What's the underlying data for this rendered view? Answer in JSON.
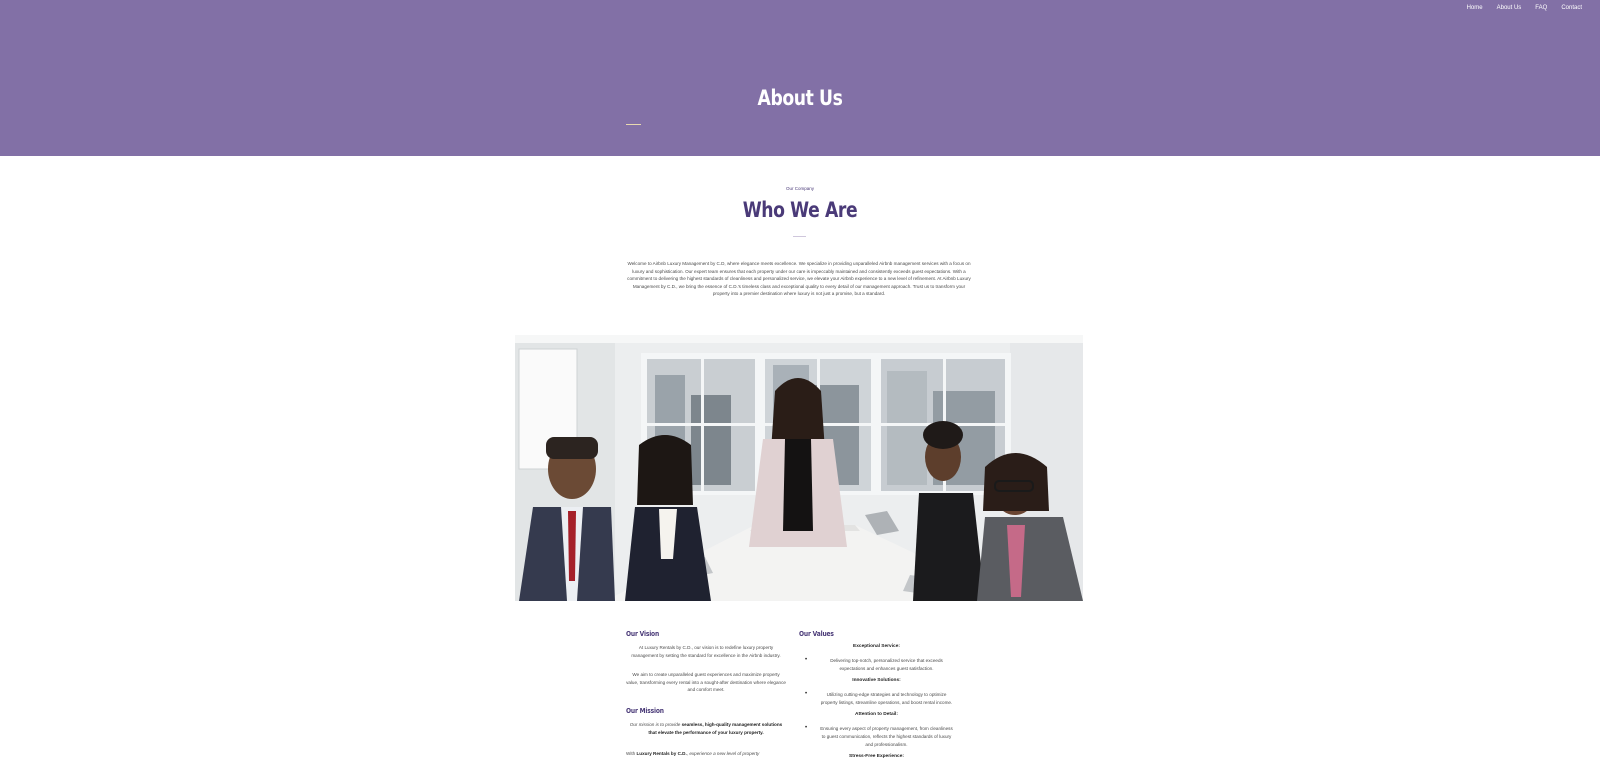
{
  "nav": {
    "items": [
      {
        "label": "Home"
      },
      {
        "label": "About Us"
      },
      {
        "label": "FAQ"
      },
      {
        "label": "Contact"
      }
    ]
  },
  "hero": {
    "title": "About Us",
    "background": "#8270a6"
  },
  "company": {
    "eyebrow": "Our Company",
    "title": "Who We Are",
    "intro": "Welcome to Airbnb Luxury Management by C.D, where elegance meets excellence. We specialize in providing unparalleled Airbnb management services with a focus on luxury and sophistication. Our expert team ensures that each property under our care is impeccably maintained and consistently exceeds guest expectations. With a commitment to delivering the highest standards of cleanliness and personalized service, we elevate your Airbnb experience to a new level of refinement. At Airbnb Luxury Management by C.D., we bring the essence of C.D.'s timeless class and exceptional quality to every detail of our management approach. Trust us to transform your property into a premier destination where luxury is not just a promise, but a standard."
  },
  "vision": {
    "title": "Our Vision",
    "p1": "At Luxury Rentals by C.D., our vision is to redefine luxury property management by setting the standard for excellence in the Airbnb industry.",
    "p2": "We aim to create unparalleled guest experiences and maximize property value, transforming every rental into a sought-after destination where elegance and comfort meet."
  },
  "mission": {
    "title": "Our Mission",
    "p1_italic": "Our mission is to provide ",
    "p1_bold": "seamless, high-quality management solutions that elevate the performance of your luxury property.",
    "p2_prefix": "With ",
    "p2_bold": "Luxury Rentals by C.D.",
    "p2_italic": ", experience a new level of property"
  },
  "values": {
    "title": "Our Values",
    "items": [
      {
        "title": "Exceptional Service:",
        "text": "Delivering top-notch, personalized service that exceeds expectations and enhances guest satisfaction."
      },
      {
        "title": "Innovative Solutions:",
        "text": "Utilizing cutting-edge strategies and technology to optimize property listings, streamline operations, and boost rental income."
      },
      {
        "title": "Attention to Detail:",
        "text": "Ensuring every aspect of property management, from cleanliness to guest communication, reflects the highest standards of luxury and professionalism."
      },
      {
        "title": "Stress-Free Experience:"
      }
    ]
  },
  "colors": {
    "accent": "#4a3a78",
    "hero": "#8270a6",
    "divider": "#e8d9b0"
  },
  "photo": {
    "icon": "team-meeting-photo"
  }
}
